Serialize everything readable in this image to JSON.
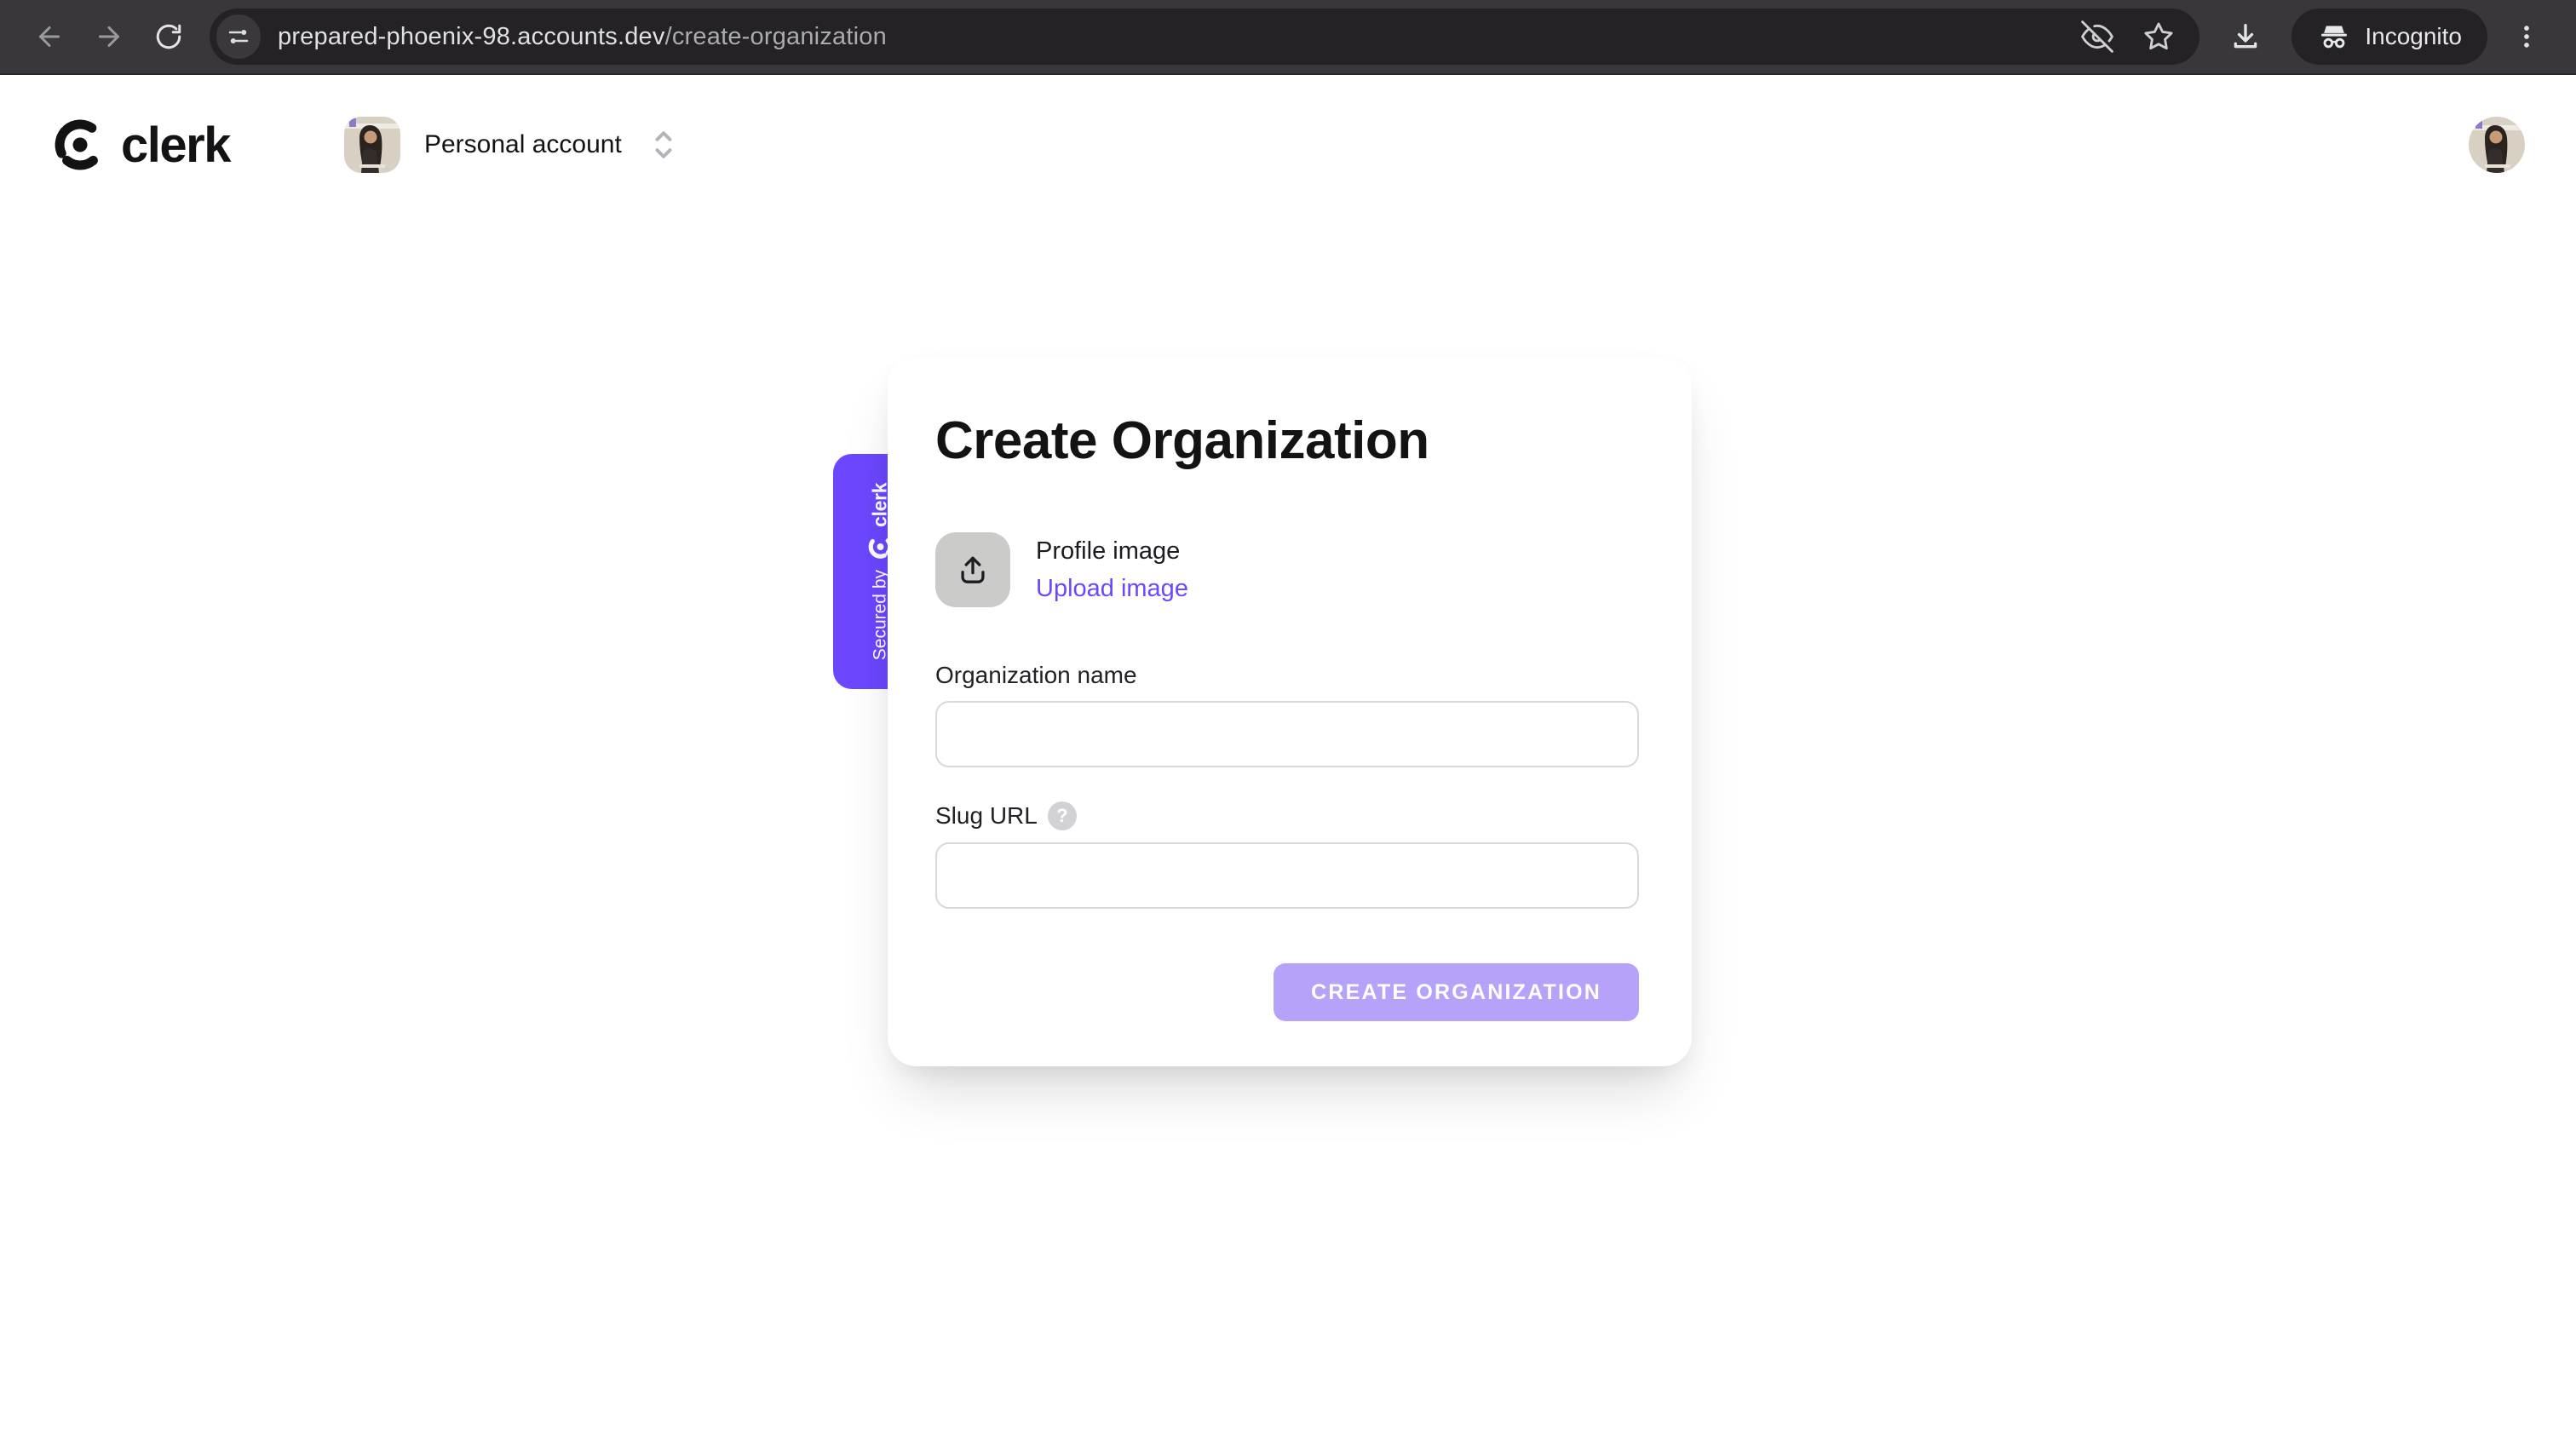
{
  "browser": {
    "url_domain": "prepared-phoenix-98.accounts.dev",
    "url_path": "/create-organization",
    "incognito_label": "Incognito",
    "icons": [
      "back-arrow",
      "forward-arrow",
      "reload",
      "site-controls",
      "eye-off",
      "bookmark-star",
      "download",
      "incognito",
      "three-dot-menu"
    ]
  },
  "header": {
    "brand": "clerk",
    "account_switcher_label": "Personal account"
  },
  "card": {
    "title": "Create Organization",
    "profile_image_label": "Profile image",
    "upload_link_label": "Upload image",
    "org_name_label": "Organization name",
    "org_name_value": "",
    "slug_label": "Slug URL",
    "slug_value": "",
    "submit_label": "CREATE ORGANIZATION"
  },
  "badge": {
    "secured_by": "Secured by",
    "brand": "clerk"
  },
  "colors": {
    "accent": "#6C47FF",
    "submit_disabled": "#B6A2F8",
    "toolbar": "#39373B",
    "url_pill": "#242226"
  }
}
